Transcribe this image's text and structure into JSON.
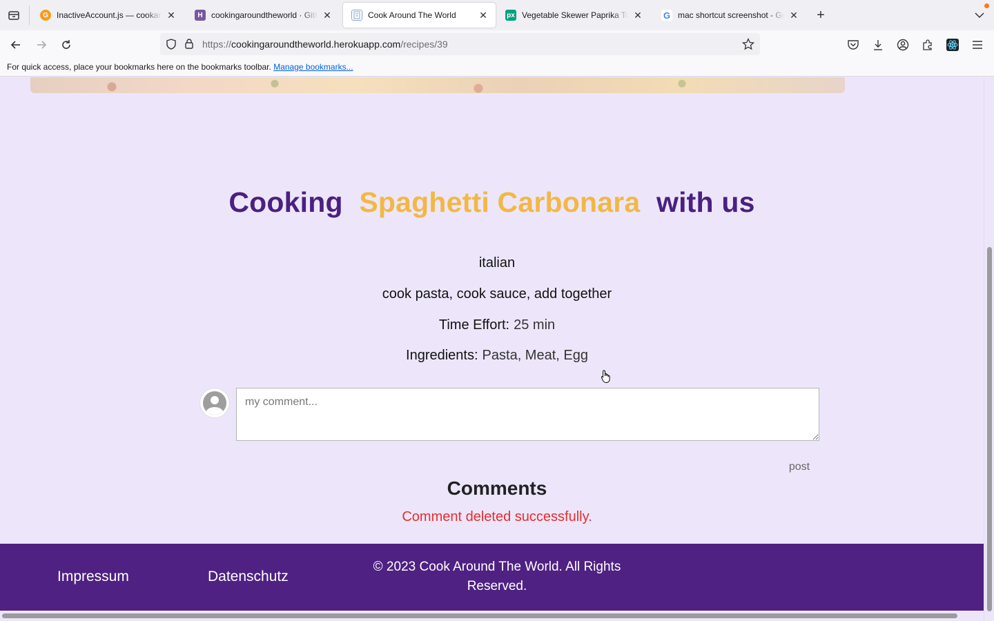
{
  "tabs": [
    {
      "title": "InactiveAccount.js — cookaround",
      "favicon": "gitkraken-icon",
      "color": "#f89c1c",
      "active": false
    },
    {
      "title": "cookingaroundtheworld · GitHub",
      "favicon": "heroku-icon",
      "color": "#79589f",
      "active": false
    },
    {
      "title": "Cook Around The World",
      "favicon": "page-icon",
      "color": "#8aa4c8",
      "active": true
    },
    {
      "title": "Vegetable Skewer Paprika Tomato",
      "favicon": "pexels-icon",
      "color": "#05a081",
      "active": false
    },
    {
      "title": "mac shortcut screenshot - Google",
      "favicon": "google-icon",
      "color": "#4285f4",
      "active": false
    }
  ],
  "url": {
    "protocol": "https://",
    "host": "cookingaroundtheworld.herokuapp.com",
    "path": "/recipes/39"
  },
  "bookmarks": {
    "message": "For quick access, place your bookmarks here on the bookmarks toolbar.",
    "link": "Manage bookmarks..."
  },
  "recipe": {
    "title_prefix": "Cooking",
    "dish": "Spaghetti Carbonara",
    "title_suffix": "with us",
    "cuisine": "italian",
    "instructions": "cook pasta, cook sauce, add together",
    "time_label": "Time Effort:",
    "time_value": "25 min",
    "ingredients_label": "Ingredients:",
    "ingredients_value": "Pasta, Meat, Egg"
  },
  "comment": {
    "placeholder": "my comment...",
    "post_label": "post"
  },
  "comments_section": {
    "heading": "Comments",
    "status": "Comment deleted successfully."
  },
  "footer": {
    "impressum": "Impressum",
    "datenschutz": "Datenschutz",
    "copyright_line1": "© 2023 Cook Around The World. All Rights",
    "copyright_line2": "Reserved."
  },
  "colors": {
    "brand_purple": "#4b2080",
    "accent_gold": "#f2b843",
    "footer_bg": "#4f2182",
    "page_bg": "#ede6fb",
    "status_red": "#e62d2d"
  }
}
